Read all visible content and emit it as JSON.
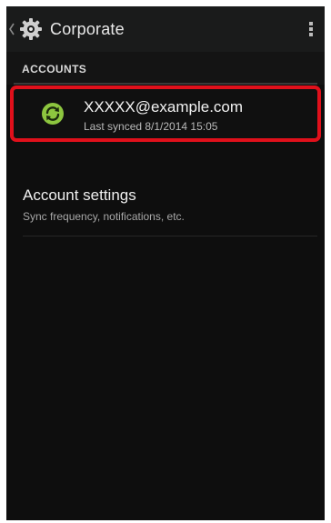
{
  "action_bar": {
    "title": "Corporate",
    "up_icon": "chevron-left-icon",
    "app_icon": "gear-icon",
    "menu_icon": "overflow-menu-icon"
  },
  "accounts_section": {
    "header": "ACCOUNTS"
  },
  "account": {
    "email": "XXXXX@example.com",
    "last_synced": "Last synced 8/1/2014 15:05",
    "icon": "sync-icon",
    "icon_color": "#8dc63f",
    "highlight_color": "#e0101b"
  },
  "settings": {
    "title": "Account settings",
    "subtitle": "Sync frequency, notifications, etc."
  }
}
